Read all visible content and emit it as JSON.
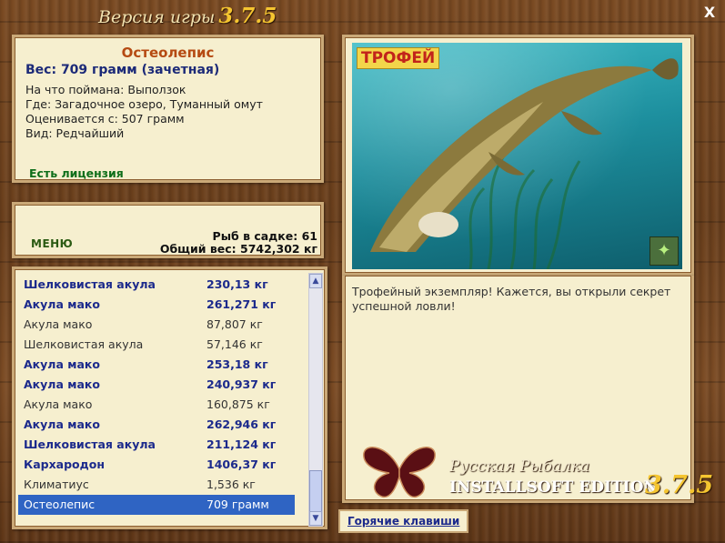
{
  "window": {
    "title": "Версия игры",
    "version": "3.7.5",
    "close_label": "X"
  },
  "info": {
    "fish_name": "Остеолепис",
    "weight": "Вес: 709 грамм (зачетная)",
    "lines": [
      "На что поймана: Выползок",
      "Где: Загадочное озеро, Туманный омут",
      "Оценивается с: 507 грамм",
      "Вид: Редчайший"
    ],
    "license": "Есть лицензия"
  },
  "stats": {
    "menu_label": "МЕНЮ",
    "fish_in_cage": "Рыб в садке: 61",
    "total_weight": "Общий вес: 5742,302 кг"
  },
  "catch_list": [
    {
      "name": "Шелковистая акула",
      "weight": "230,13 кг",
      "style": "b"
    },
    {
      "name": "Акула мако",
      "weight": "261,271 кг",
      "style": "b"
    },
    {
      "name": "Акула мако",
      "weight": "87,807 кг",
      "style": "p"
    },
    {
      "name": "Шелковистая акула",
      "weight": "57,146 кг",
      "style": "p"
    },
    {
      "name": "Акула мако",
      "weight": "253,18 кг",
      "style": "b"
    },
    {
      "name": "Акула мако",
      "weight": "240,937 кг",
      "style": "b"
    },
    {
      "name": "Акула мако",
      "weight": "160,875 кг",
      "style": "p"
    },
    {
      "name": "Акула мако",
      "weight": "262,946 кг",
      "style": "b"
    },
    {
      "name": "Шелковистая акула",
      "weight": "211,124 кг",
      "style": "b"
    },
    {
      "name": "Кархародон",
      "weight": "1406,37 кг",
      "style": "b"
    },
    {
      "name": "Климатиус",
      "weight": "1,536 кг",
      "style": "p"
    },
    {
      "name": "Остеолепис",
      "weight": "709 грамм",
      "style": "sel"
    }
  ],
  "trophy": {
    "badge": "ТРОФЕЙ",
    "description": "Трофейный экземпляр! Кажется, вы открыли секрет успешной ловли!"
  },
  "hotkeys_label": "Горячие клавиши",
  "brand": {
    "line1": "Русская Рыбалка",
    "line2": "INSTALLSOFT EDITION",
    "version": "3.7.5"
  },
  "icons": {
    "close": "close-icon",
    "scroll_up": "arrow-up-icon",
    "scroll_down": "arrow-down-icon",
    "butterfly": "butterfly-icon"
  },
  "colors": {
    "accent_name": "#b54a12",
    "accent_blue": "#1c2a8c",
    "selection": "#2f64c3",
    "license": "#0e6e1a"
  }
}
